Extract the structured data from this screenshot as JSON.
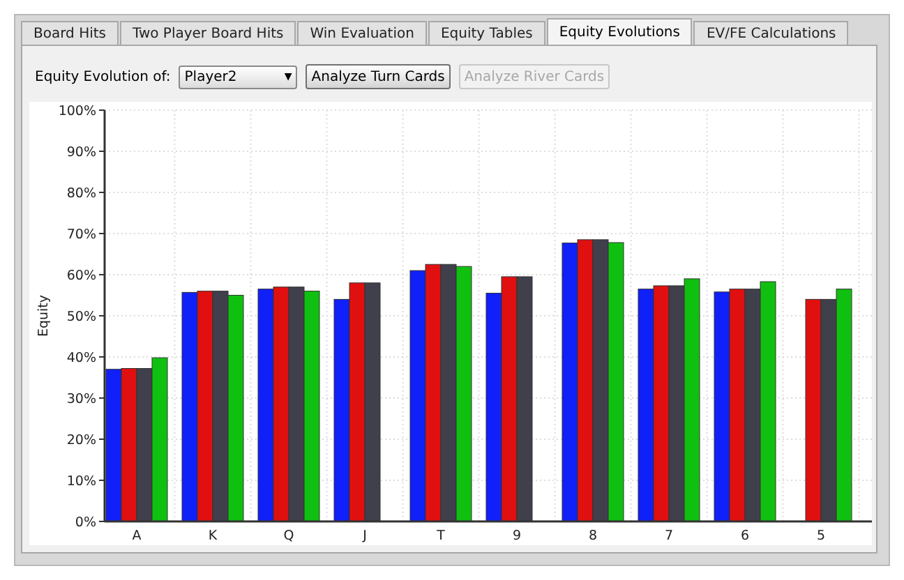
{
  "tabs": [
    {
      "label": "Board Hits",
      "selected": false
    },
    {
      "label": "Two Player Board Hits",
      "selected": false
    },
    {
      "label": "Win Evaluation",
      "selected": false
    },
    {
      "label": "Equity Tables",
      "selected": false
    },
    {
      "label": "Equity Evolutions",
      "selected": true
    },
    {
      "label": "EV/FE Calculations",
      "selected": false
    }
  ],
  "toolbar": {
    "label": "Equity Evolution of:",
    "dropdown": {
      "value": "Player2",
      "arrow": "▼"
    },
    "buttons": [
      {
        "label": "Analyze Turn Cards",
        "disabled": false
      },
      {
        "label": "Analyze River Cards",
        "disabled": true
      }
    ]
  },
  "chart_data": {
    "type": "bar",
    "ylabel": "Equity",
    "categories": [
      "A",
      "K",
      "Q",
      "J",
      "T",
      "9",
      "8",
      "7",
      "6",
      "5"
    ],
    "series": [
      {
        "color": "#1020f8",
        "values": [
          37,
          55.7,
          56.5,
          54,
          61,
          55.5,
          67.7,
          56.5,
          55.8,
          null
        ]
      },
      {
        "color": "#e01010",
        "values": [
          37.2,
          56,
          57,
          58,
          62.5,
          59.5,
          68.5,
          57.3,
          56.5,
          54
        ]
      },
      {
        "color": "#40404c",
        "values": [
          37.2,
          56,
          57,
          58,
          62.5,
          59.5,
          68.5,
          57.3,
          56.5,
          54
        ]
      },
      {
        "color": "#10c010",
        "values": [
          39.8,
          55,
          56,
          null,
          62,
          null,
          67.8,
          59,
          58.3,
          56.5
        ]
      }
    ],
    "ylim": [
      0,
      100
    ],
    "grid": true,
    "yticks": [
      {
        "value": 0,
        "label": "0%"
      },
      {
        "value": 10,
        "label": "10%"
      },
      {
        "value": 20,
        "label": "20%"
      },
      {
        "value": 30,
        "label": "30%"
      },
      {
        "value": 40,
        "label": "40%"
      },
      {
        "value": 50,
        "label": "50%"
      },
      {
        "value": 60,
        "label": "60%"
      },
      {
        "value": 70,
        "label": "70%"
      },
      {
        "value": 80,
        "label": "80%"
      },
      {
        "value": 90,
        "label": "90%"
      },
      {
        "value": 100,
        "label": "100%"
      }
    ]
  }
}
